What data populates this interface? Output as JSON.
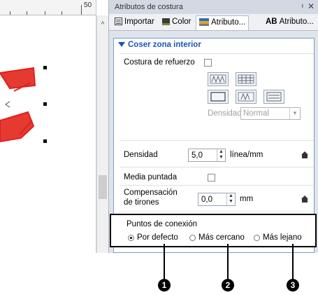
{
  "ruler": {
    "label": "50"
  },
  "panel": {
    "title": "Atributos de costura",
    "pin_icon": "pin-icon",
    "close_icon": "close-icon"
  },
  "tabs": [
    {
      "label": "Importar",
      "icon": "import-icon"
    },
    {
      "label": "Color",
      "icon": "color-icon"
    },
    {
      "label": "Atributo...",
      "icon": "attributes-icon",
      "active": true
    },
    {
      "label": "Atributo...",
      "icon_text": "AB"
    }
  ],
  "section": {
    "title": "Coser zona interior"
  },
  "reinforce": {
    "label": "Costura de refuerzo"
  },
  "density_disabled": {
    "label": "Densidad",
    "value": "Normal"
  },
  "density": {
    "label": "Densidad",
    "value": "5,0",
    "unit": "línea/mm"
  },
  "half_stitch": {
    "label": "Media puntada"
  },
  "pull_comp": {
    "label_1": "Compensación",
    "label_2": "de tirones",
    "value": "0,0",
    "unit": "mm"
  },
  "connection": {
    "title": "Puntos de conexión",
    "options": [
      "Por defecto",
      "Más cercano",
      "Más lejano"
    ],
    "selected": "Por defecto"
  },
  "callouts": [
    "1",
    "2",
    "3"
  ],
  "colors": {
    "accent": "#1c56b4",
    "design_red": "#e0201c"
  }
}
